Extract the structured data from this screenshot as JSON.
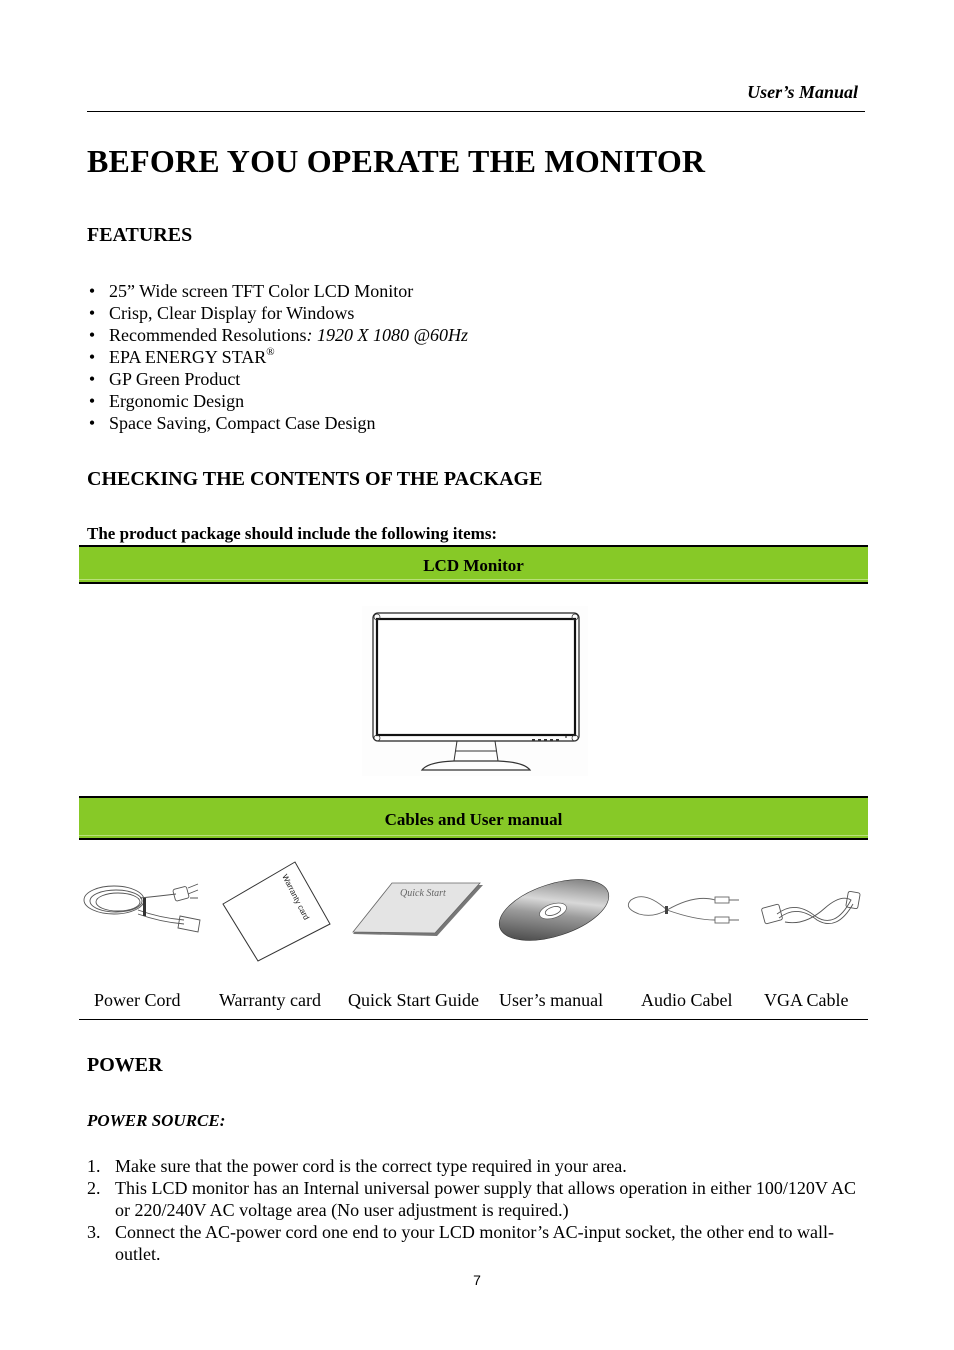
{
  "header": {
    "running_title": "User’s Manual"
  },
  "page_title": "BEFORE YOU OPERATE THE MONITOR",
  "features": {
    "heading": "FEATURES",
    "bullet_glyph": "•",
    "items": [
      {
        "text": "25” Wide screen TFT Color LCD Monitor"
      },
      {
        "text": "Crisp, Clear Display for Windows"
      },
      {
        "text": "Recommended Resolutions",
        "italic_suffix": ": 1920 X 1080 @60Hz"
      },
      {
        "text": "EPA ENERGY STAR",
        "superscript": "®"
      },
      {
        "text": "GP Green Product"
      },
      {
        "text": "Ergonomic Design"
      },
      {
        "text": "Space Saving, Compact Case Design"
      }
    ]
  },
  "package": {
    "heading": "CHECKING THE CONTENTS OF THE PACKAGE",
    "intro": "The product package should include the following items:",
    "accent_color": "#87c927",
    "sections": [
      {
        "title": "LCD Monitor",
        "illustrations": [
          "lcd-monitor-icon"
        ]
      },
      {
        "title": "Cables and User manual",
        "items": [
          {
            "label": "Power Cord",
            "icon": "power-cord-icon"
          },
          {
            "label": "Warranty card",
            "icon": "warranty-card-icon",
            "printed_text": "Warranty card"
          },
          {
            "label": "Quick Start Guide",
            "icon": "quick-start-guide-icon",
            "printed_text": "Quick Start"
          },
          {
            "label": "User’s manual",
            "icon": "cd-disc-icon"
          },
          {
            "label": "Audio Cabel",
            "icon": "audio-cable-icon"
          },
          {
            "label": "VGA Cable",
            "icon": "vga-cable-icon"
          }
        ]
      }
    ]
  },
  "power": {
    "heading": "POWER",
    "subheading": "POWER SOURCE:",
    "steps": [
      {
        "num": "1.",
        "text": "Make sure that the power cord is the correct type required in your area."
      },
      {
        "num": "2.",
        "text": "This LCD monitor has an Internal universal power supply that allows operation in either 100/120V AC or 220/240V AC voltage area (No user adjustment is required.)"
      },
      {
        "num": "3.",
        "text": "Connect the AC-power cord one end to your LCD monitor’s AC-input socket, the other end to wall-outlet."
      }
    ]
  },
  "page_number": "7"
}
